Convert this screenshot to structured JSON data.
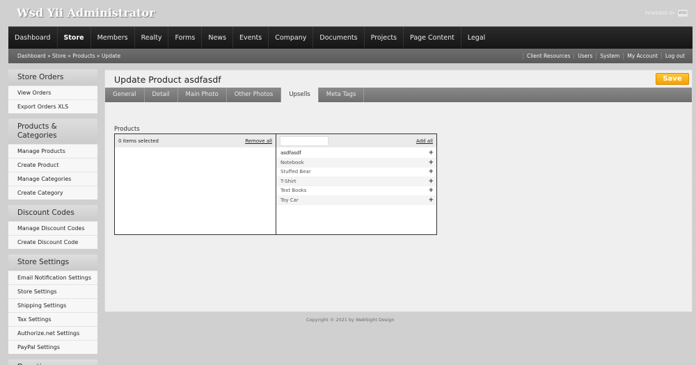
{
  "app": {
    "title": "Wsd Yii Administrator",
    "powered_by": "POWERED BY",
    "powered_logo": "WSD"
  },
  "topnav": {
    "items": [
      "Dashboard",
      "Store",
      "Members",
      "Realty",
      "Forms",
      "News",
      "Events",
      "Company",
      "Documents",
      "Projects",
      "Page Content",
      "Legal"
    ],
    "active": "Store"
  },
  "breadcrumb": "Dashboard » Store » Products » Update",
  "utility_links": [
    "Client Resources",
    "Users",
    "System",
    "My Account",
    "Log out"
  ],
  "sidebar": {
    "groups": [
      {
        "title": "Store Orders",
        "items": [
          "View Orders",
          "Export Orders XLS"
        ]
      },
      {
        "title": "Products & Categories",
        "items": [
          "Manage Products",
          "Create Product",
          "Manage Categories",
          "Create Category"
        ]
      },
      {
        "title": "Discount Codes",
        "items": [
          "Manage Discount Codes",
          "Create Discount Code"
        ]
      },
      {
        "title": "Store Settings",
        "items": [
          "Email Notification Settings",
          "Store Settings",
          "Shipping Settings",
          "Tax Settings",
          "Authorize.net Settings",
          "PayPal Settings"
        ]
      },
      {
        "title": "Donations",
        "items": []
      }
    ]
  },
  "main": {
    "title": "Update Product asdfasdf",
    "save_label": "Save",
    "tabs": [
      "General",
      "Detail",
      "Main Photo",
      "Other Photos",
      "Upsells",
      "Meta Tags"
    ],
    "active_tab": "Upsells",
    "products_field": {
      "label": "Products",
      "selected_count_text": "0 items selected",
      "remove_all_label": "Remove all",
      "add_all_label": "Add all",
      "search_value": "",
      "add_symbol": "+",
      "available": [
        "asdfasdf",
        "Notebook",
        "Stuffed Bear",
        "T-Shirt",
        "Text Books",
        "Toy Car"
      ]
    }
  },
  "footer": "Copyright © 2021 by WebSight Design",
  "colors": {
    "save_button": "#f5a300",
    "nav_background": "#1c1c1c",
    "page_background": "#cfcfcf"
  }
}
